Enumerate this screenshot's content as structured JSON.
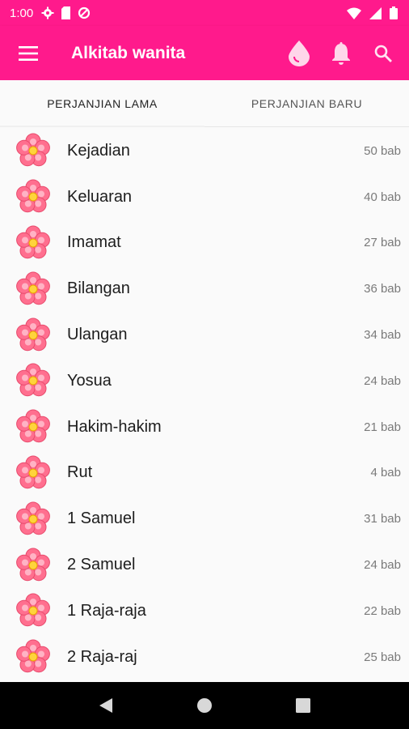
{
  "status": {
    "time": "1:00"
  },
  "app": {
    "title": "Alkitab wanita",
    "accent": "#ff1a8c"
  },
  "icons": [
    "menu-icon",
    "drop-icon",
    "bell-icon",
    "search-icon",
    "flower-icon"
  ],
  "tabs": [
    {
      "label": "PERJANJIAN LAMA",
      "active": true
    },
    {
      "label": "PERJANJIAN BARU",
      "active": false
    }
  ],
  "books": [
    {
      "name": "Kejadian",
      "count": "50 bab"
    },
    {
      "name": "Keluaran",
      "count": "40 bab"
    },
    {
      "name": "Imamat",
      "count": "27 bab"
    },
    {
      "name": "Bilangan",
      "count": "36 bab"
    },
    {
      "name": "Ulangan",
      "count": "34 bab"
    },
    {
      "name": "Yosua",
      "count": "24 bab"
    },
    {
      "name": "Hakim-hakim",
      "count": "21 bab"
    },
    {
      "name": "Rut",
      "count": "4 bab"
    },
    {
      "name": "1 Samuel",
      "count": "31 bab"
    },
    {
      "name": "2 Samuel",
      "count": "24 bab"
    },
    {
      "name": "1 Raja-raja",
      "count": "22 bab"
    },
    {
      "name": "2 Raja-raj",
      "count": "25 bab"
    }
  ]
}
